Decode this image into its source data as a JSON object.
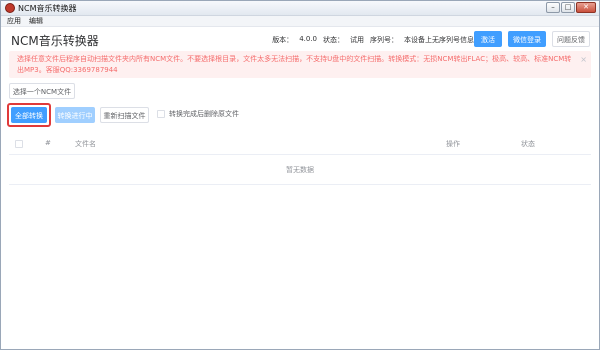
{
  "window": {
    "title": "NCM音乐转换器",
    "minimize": "–",
    "maximize": "□",
    "close": "✕"
  },
  "menu": {
    "items": [
      "应用",
      "编辑"
    ]
  },
  "header": {
    "title": "NCM音乐转换器",
    "version_label": "版本：",
    "version": "4.0.0",
    "status_label": "状态：",
    "status": "试用",
    "serial_label": "序列号：",
    "serial": "本设备上无序列号信息",
    "activate_label": "激活",
    "wechat_login_label": "微信登录",
    "feedback_label": "问题反馈"
  },
  "alert": {
    "text": "选择任意文件后程序自动扫描文件夹内所有NCM文件。不要选择根目录，文件太多无法扫描，不支持U盘中的文件扫描。转换模式：无损NCM转出FLAC；极高、较高、标准NCM转出MP3。客服QQ:3369787944",
    "close_icon": "×"
  },
  "toolbar": {
    "select_file_label": "选择一个NCM文件",
    "convert_all_label": "全部转换",
    "converting_label": "转换进行中",
    "rescan_label": "重新扫描文件",
    "delete_after_label": "转换完成后删除原文件"
  },
  "table": {
    "columns": [
      "#",
      "文件名",
      "操作",
      "状态"
    ],
    "empty_text": "暂无数据"
  },
  "colors": {
    "primary": "#409eff",
    "danger": "#f56c6c",
    "highlight": "#e03a3a"
  }
}
